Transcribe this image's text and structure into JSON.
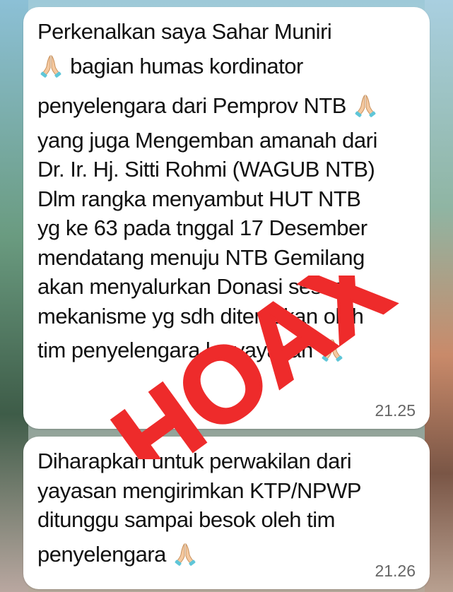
{
  "messages": [
    {
      "lines": [
        "Perkenalkan saya Sahar Muniri",
        "bagian humas kordinator",
        "penyelengara dari Pemprov NTB",
        "yang juga Mengemban amanah dari",
        "Dr. Ir. Hj. Sitti Rohmi (WAGUB NTB)",
        "Dlm rangka menyambut HUT NTB",
        "yg ke 63 pada tnggal 17 Desember",
        "mendatang menuju NTB Gemilang",
        "akan menyalurkan Donasi sesuai",
        "mekanisme yg sdh ditentukan oleh",
        "tim penyelengara ke yayasan"
      ],
      "time": "21.25"
    },
    {
      "lines": [
        "Diharapkan untuk perwakilan dari",
        "yayasan mengirimkan KTP/NPWP",
        "ditunggu sampai besok oleh tim",
        "penyelengara"
      ],
      "time": "21.26"
    }
  ],
  "stamp": {
    "text": "HOAX",
    "color": "#ee2b2b"
  },
  "icons": {
    "pray": "folded-hands-icon"
  }
}
